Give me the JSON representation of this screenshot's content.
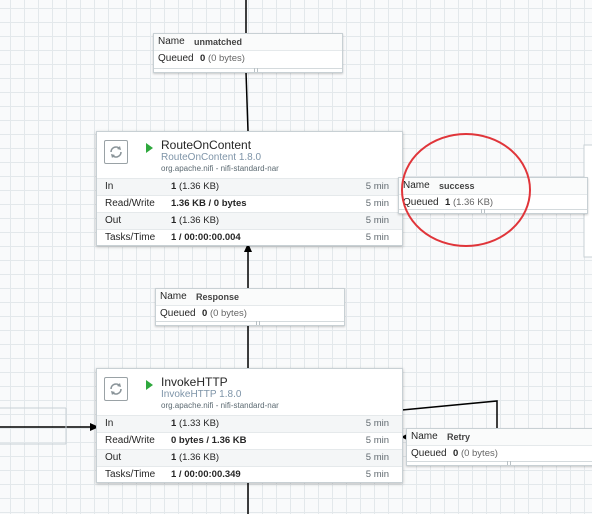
{
  "processors": [
    {
      "name": "RouteOnContent",
      "type": "RouteOnContent 1.8.0",
      "bundle": "org.apache.nifi - nifi-standard-nar",
      "icon": "processor-icon",
      "status_icon": "running-icon",
      "stats": [
        {
          "label": "In",
          "value": "1",
          "detail": "(1.36 KB)",
          "time": "5 min"
        },
        {
          "label": "Read/Write",
          "value": "1.36 KB / 0 bytes",
          "detail": "",
          "time": "5 min"
        },
        {
          "label": "Out",
          "value": "1",
          "detail": "(1.36 KB)",
          "time": "5 min"
        },
        {
          "label": "Tasks/Time",
          "value": "1 / 00:00:00.004",
          "detail": "",
          "time": "5 min"
        }
      ]
    },
    {
      "name": "InvokeHTTP",
      "type": "InvokeHTTP 1.8.0",
      "bundle": "org.apache.nifi - nifi-standard-nar",
      "icon": "processor-icon",
      "status_icon": "running-icon",
      "stats": [
        {
          "label": "In",
          "value": "1",
          "detail": "(1.33 KB)",
          "time": "5 min"
        },
        {
          "label": "Read/Write",
          "value": "0 bytes / 1.36 KB",
          "detail": "",
          "time": "5 min"
        },
        {
          "label": "Out",
          "value": "1",
          "detail": "(1.36 KB)",
          "time": "5 min"
        },
        {
          "label": "Tasks/Time",
          "value": "1 / 00:00:00.349",
          "detail": "",
          "time": "5 min"
        }
      ]
    }
  ],
  "connections": [
    {
      "name_label": "Name",
      "name": "unmatched",
      "queued_label": "Queued",
      "queued": "0",
      "queued_detail": "(0 bytes)"
    },
    {
      "name_label": "Name",
      "name": "success",
      "queued_label": "Queued",
      "queued": "1",
      "queued_detail": "(1.36 KB)"
    },
    {
      "name_label": "Name",
      "name": "Response",
      "queued_label": "Queued",
      "queued": "0",
      "queued_detail": "(0 bytes)"
    },
    {
      "name_label": "Name",
      "name": "Retry",
      "queued_label": "Queued",
      "queued": "0",
      "queued_detail": "(0 bytes)"
    }
  ],
  "colors": {
    "highlight_circle": "#e0353a",
    "running": "#2ea83d",
    "type_text": "#7e94a8"
  }
}
